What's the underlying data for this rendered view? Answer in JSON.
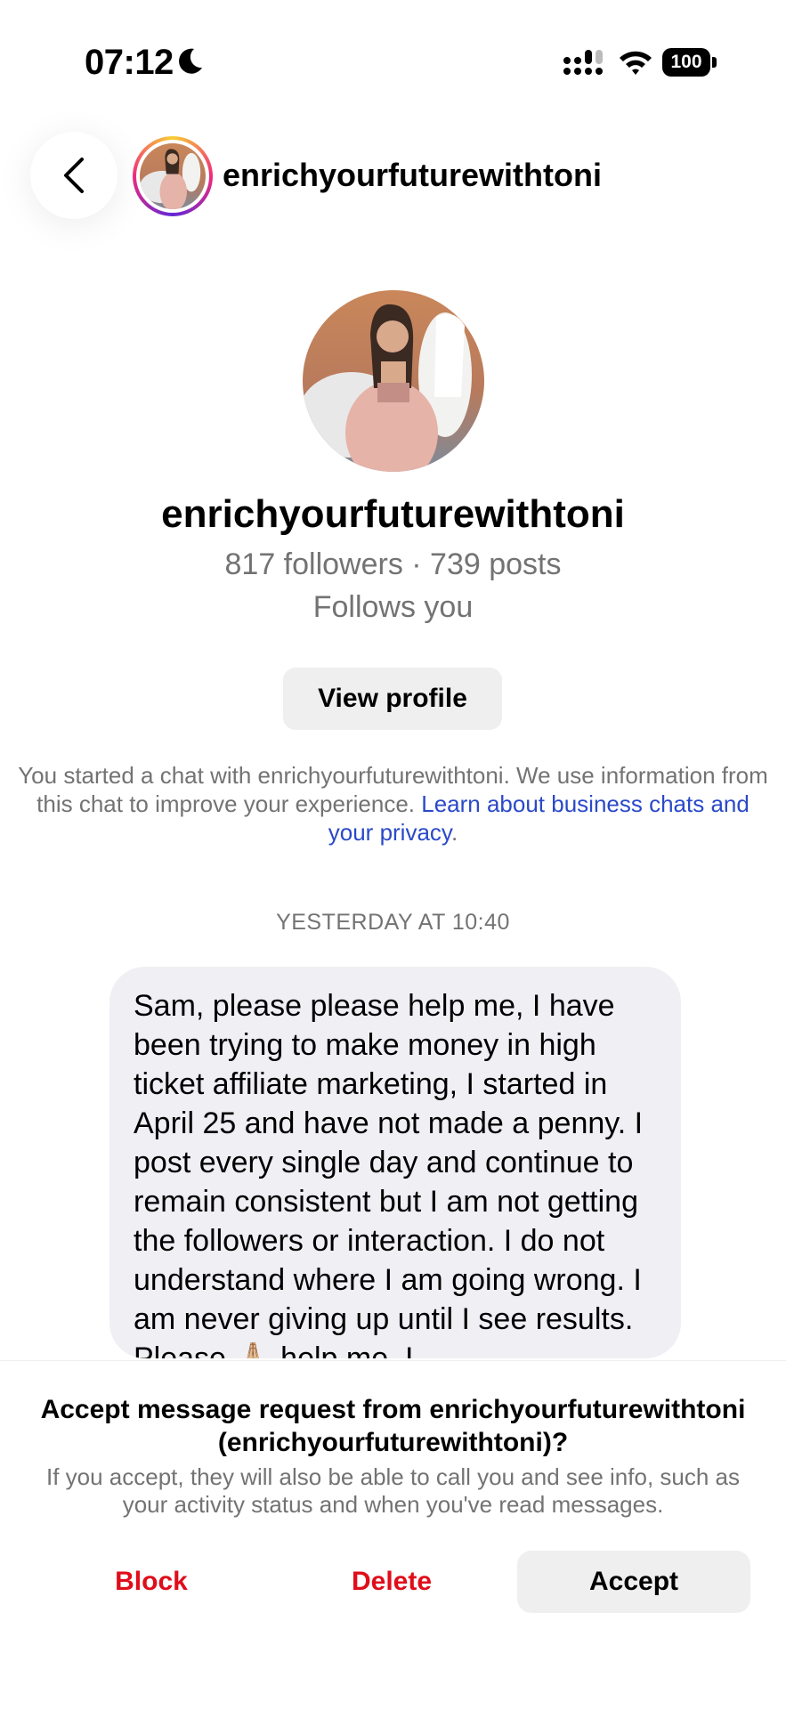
{
  "status_bar": {
    "time": "07:12",
    "battery": "100"
  },
  "header": {
    "username": "enrichyourfuturewithtoni"
  },
  "profile": {
    "name": "enrichyourfuturewithtoni",
    "stats": "817 followers · 739 posts",
    "follows": "Follows you",
    "view_profile_label": "View profile"
  },
  "info": {
    "text": "You started a chat with enrichyourfuturewithtoni. We use information from this chat to improve your experience. ",
    "link": "Learn about business chats and your privacy",
    "period": "."
  },
  "chat": {
    "timestamp": "YESTERDAY AT 10:40",
    "message": "Sam, please please help me, I have been trying to make money in high ticket affiliate marketing, I started in April 25 and have not made a penny. I post every single day and continue to remain consistent but I am not getting the followers or interaction. I do not understand where I am going wrong. I am never giving up until I see results. Please 🙏🏼 help me. I"
  },
  "request": {
    "title": "Accept message request from enrichyourfuturewithtoni (enrichyourfuturewithtoni)?",
    "subtitle": "If you accept, they will also be able to call you and see info, such as your activity status and when you've read messages.",
    "block_label": "Block",
    "delete_label": "Delete",
    "accept_label": "Accept"
  },
  "colors": {
    "danger": "#e00d1a",
    "link": "#2a49c8",
    "bubble": "#efeff4",
    "muted": "#737373"
  }
}
